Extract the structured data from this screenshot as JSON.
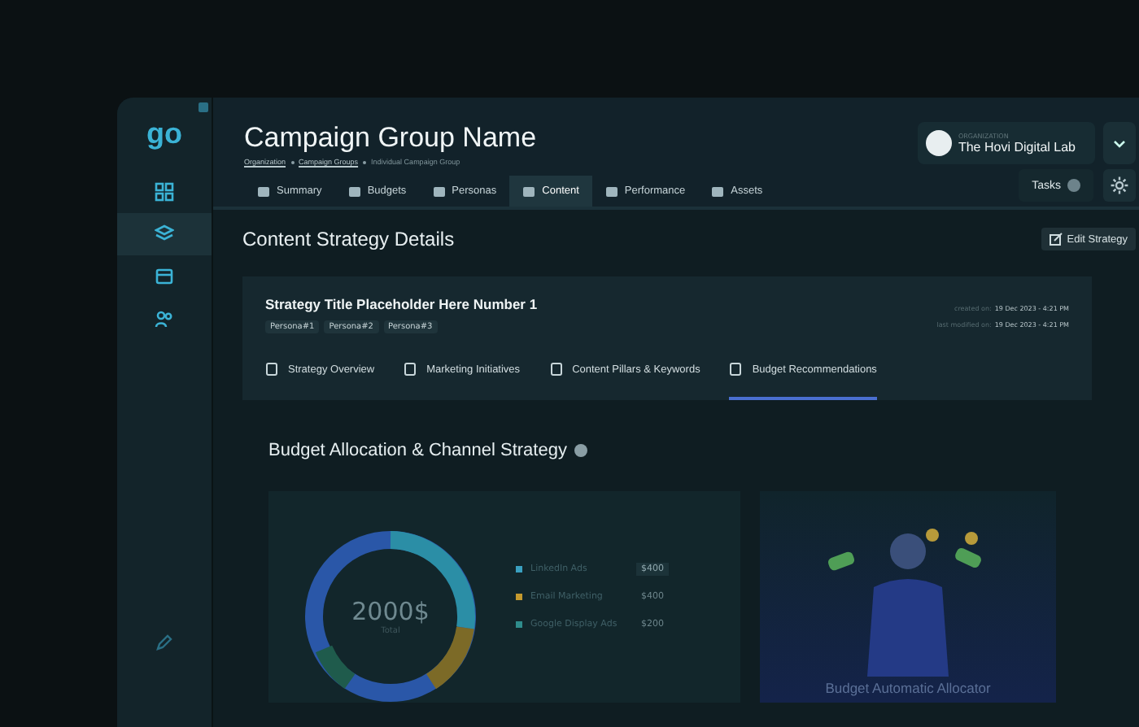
{
  "sidebar": {
    "logo": "go",
    "items": [
      {
        "selected": false
      },
      {
        "selected": true
      },
      {
        "selected": false
      },
      {
        "selected": false
      }
    ]
  },
  "header": {
    "title": "Campaign Group Name",
    "breadcrumb": [
      {
        "label": "Organization",
        "link": true
      },
      {
        "label": "Campaign Groups",
        "link": true
      },
      {
        "label": "Individual Campaign Group",
        "link": false
      }
    ],
    "organization": {
      "label": "ORGANIZATION",
      "name": "The Hovi Digital Lab"
    }
  },
  "tabs": [
    {
      "label": "Summary",
      "selected": false
    },
    {
      "label": "Budgets",
      "selected": false
    },
    {
      "label": "Personas",
      "selected": false
    },
    {
      "label": "Content",
      "selected": true
    },
    {
      "label": "Performance",
      "selected": false
    },
    {
      "label": "Assets",
      "selected": false
    }
  ],
  "tasks_button": {
    "label": "Tasks"
  },
  "section": {
    "title": "Content Strategy Details",
    "edit_button": "Edit Strategy"
  },
  "strategy": {
    "title": "Strategy Title Placeholder Here Number 1",
    "personas": [
      "Persona#1",
      "Persona#2",
      "Persona#3"
    ],
    "meta": [
      {
        "label": "created on:",
        "value": "19 Dec 2023 - 4:21 PM"
      },
      {
        "label": "last modified on:",
        "value": "19 Dec 2023 - 4:21 PM"
      }
    ],
    "tabs": [
      {
        "label": "Strategy Overview",
        "selected": false
      },
      {
        "label": "Marketing Initiatives",
        "selected": false
      },
      {
        "label": "Content Pillars & Keywords",
        "selected": false
      },
      {
        "label": "Budget Recommendations",
        "selected": true
      }
    ]
  },
  "budget": {
    "title": "Budget Allocation & Channel Strategy",
    "total": "2000$",
    "total_label": "Total",
    "legend": [
      {
        "name": "LinkedIn Ads",
        "amount": "$400",
        "color": "#3aa0c0",
        "highlighted": true
      },
      {
        "name": "Email Marketing",
        "amount": "$400",
        "color": "#c59a2e",
        "highlighted": false
      },
      {
        "name": "Google Display Ads",
        "amount": "$200",
        "color": "#2f8c8c",
        "highlighted": false
      }
    ],
    "allocator_title": "Budget Automatic Allocator"
  }
}
